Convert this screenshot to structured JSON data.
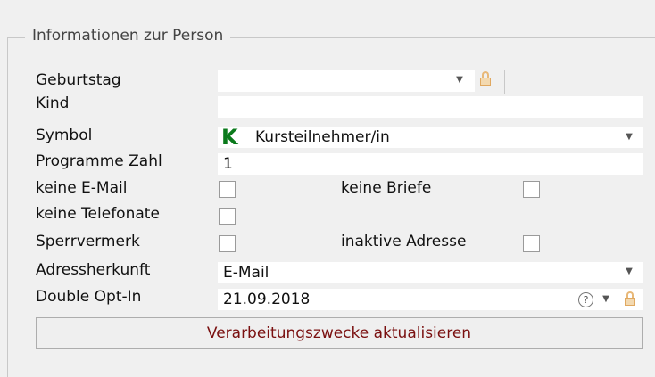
{
  "group": {
    "title": "Informationen zur Person"
  },
  "fields": {
    "geburtstag_label": "Geburtstag",
    "geburtstag_value": "",
    "kind_label": "Kind",
    "kind_value": "",
    "symbol_label": "Symbol",
    "symbol_value": "Kursteilnehmer/in",
    "symbol_icon_letter": "K",
    "programme_label": "Programme Zahl",
    "programme_value": "1",
    "keine_email_label": "keine E-Mail",
    "keine_briefe_label": "keine Briefe",
    "keine_telefonate_label": "keine Telefonate",
    "sperrvermerk_label": "Sperrvermerk",
    "inaktive_adresse_label": "inaktive Adresse",
    "adressherkunft_label": "Adressherkunft",
    "adressherkunft_value": "E-Mail",
    "double_optin_label": "Double Opt-In",
    "double_optin_value": "21.09.2018"
  },
  "checkboxes": {
    "keine_email": false,
    "keine_briefe": false,
    "keine_telefonate": false,
    "sperrvermerk": false,
    "inaktive_adresse": false
  },
  "button": {
    "label": "Verarbeitungszwecke aktualisieren"
  },
  "icons": {
    "dropdown": "▼",
    "help": "?"
  },
  "colors": {
    "symbol_icon": "#0b7a1c",
    "button_text": "#7a1010",
    "lock": "#e8b878"
  }
}
